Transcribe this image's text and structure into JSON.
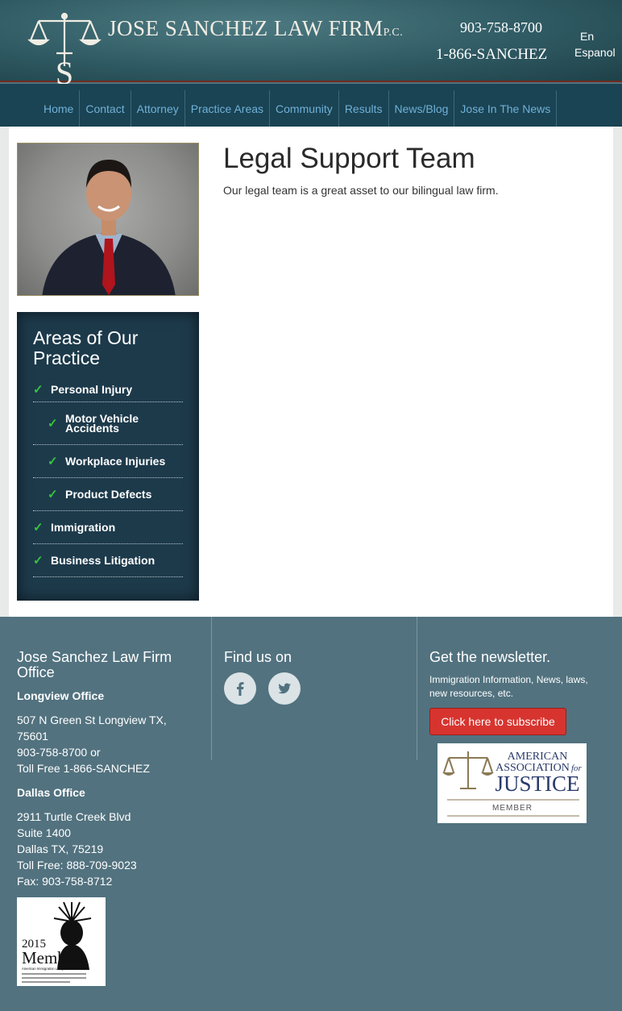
{
  "header": {
    "firm_name": "JOSE SANCHEZ LAW FIRM",
    "firm_suffix": "P.C.",
    "logo_letter": "S",
    "phone_local": "903-758-8700",
    "phone_toll": "1-866-SANCHEZ",
    "lang_en": "En",
    "lang_es": "Espanol"
  },
  "nav": {
    "items": [
      {
        "label": "Home"
      },
      {
        "label": "Contact"
      },
      {
        "label": "Attorney"
      },
      {
        "label": "Practice Areas"
      },
      {
        "label": "Community"
      },
      {
        "label": "Results"
      },
      {
        "label": "News/Blog"
      },
      {
        "label": "Jose In The News"
      }
    ]
  },
  "sidebar": {
    "practice_title": "Areas of Our Practice",
    "practice_items": [
      {
        "label": "Personal Injury",
        "sub": false
      },
      {
        "label": "Motor Vehicle Accidents",
        "sub": true
      },
      {
        "label": "Workplace Injuries",
        "sub": true
      },
      {
        "label": "Product Defects",
        "sub": true
      },
      {
        "label": "Immigration",
        "sub": false
      },
      {
        "label": "Business Litigation",
        "sub": false
      }
    ]
  },
  "content": {
    "title": "Legal Support Team",
    "text": "Our legal team is a great asset to our bilingual law firm."
  },
  "footer": {
    "office_heading": "Jose Sanchez Law Firm Office",
    "longview": {
      "title": "Longview Office",
      "lines": [
        "507 N Green St Longview TX,",
        "75601",
        "903-758-8700 or",
        "Toll Free 1-866-SANCHEZ"
      ]
    },
    "dallas": {
      "title": "Dallas Office",
      "lines": [
        "2911 Turtle Creek Blvd",
        "Suite 1400",
        "Dallas TX, 75219",
        "Toll Free: 888-709-9023",
        "Fax: 903-758-8712"
      ]
    },
    "find_us": "Find us on",
    "newsletter_heading": "Get the newsletter.",
    "newsletter_text": "Immigration Information, News, laws, new resources, etc.",
    "subscribe_label": "Click here to subscribe",
    "aaj_badge": {
      "line1": "AMERICAN",
      "line2": "ASSOCIATION",
      "line2b": "for",
      "line3": "JUSTICE",
      "line4": "MEMBER"
    },
    "aila_badge": {
      "year": "2015",
      "word": "Member",
      "org": "American Immigration Lawyers Association"
    }
  },
  "colors": {
    "nav_link": "#6fb1d8",
    "nav_bg": "#1a4353",
    "footer_bg": "#52727f",
    "subscribe": "#d7342f",
    "check": "#37c43c"
  }
}
